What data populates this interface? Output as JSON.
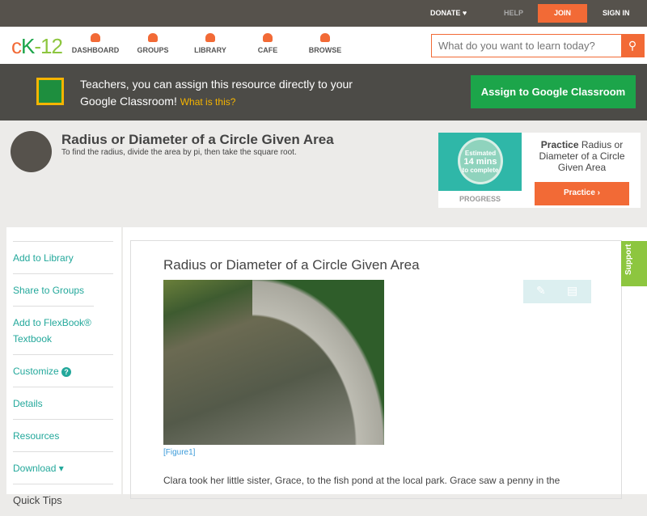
{
  "topbar": {
    "donate": "DONATE ♥",
    "help": "HELP",
    "join": "JOIN",
    "signin": "SIGN IN"
  },
  "nav": {
    "logo": "CK-12",
    "items": [
      "DASHBOARD",
      "GROUPS",
      "LIBRARY",
      "CAFE",
      "BROWSE"
    ],
    "search_placeholder": "What do you want to learn today?"
  },
  "banner": {
    "text": "Teachers, you can assign this resource directly to your Google Classroom!",
    "link": "What is this?",
    "button": "Assign to Google Classroom"
  },
  "concept": {
    "title": "Radius or Diameter of a Circle Given Area",
    "subtitle": "To find the radius, divide the area by pi, then take the square root."
  },
  "practice": {
    "estimate_1": "Estimated",
    "estimate_2": "14 mins",
    "estimate_3": "to complete",
    "progress": "PROGRESS",
    "bold": "Practice",
    "title": "Radius or Diameter of a Circle Given Area",
    "button": "Practice"
  },
  "sidebar": {
    "items": [
      "Add to Library",
      "Share to Groups",
      "Add to FlexBook® Textbook",
      "Customize",
      "Details",
      "Resources",
      "Download ▾"
    ],
    "quick_tips": "Quick Tips"
  },
  "article": {
    "title": "Radius or Diameter of a Circle Given Area",
    "figure": "[Figure1]",
    "text": "Clara took her little sister, Grace, to the fish pond at the local park. Grace saw a penny in the"
  },
  "support": "Support",
  "colors": {
    "accent": "#f26a36",
    "teal": "#23a89b",
    "green": "#1ca54a"
  }
}
